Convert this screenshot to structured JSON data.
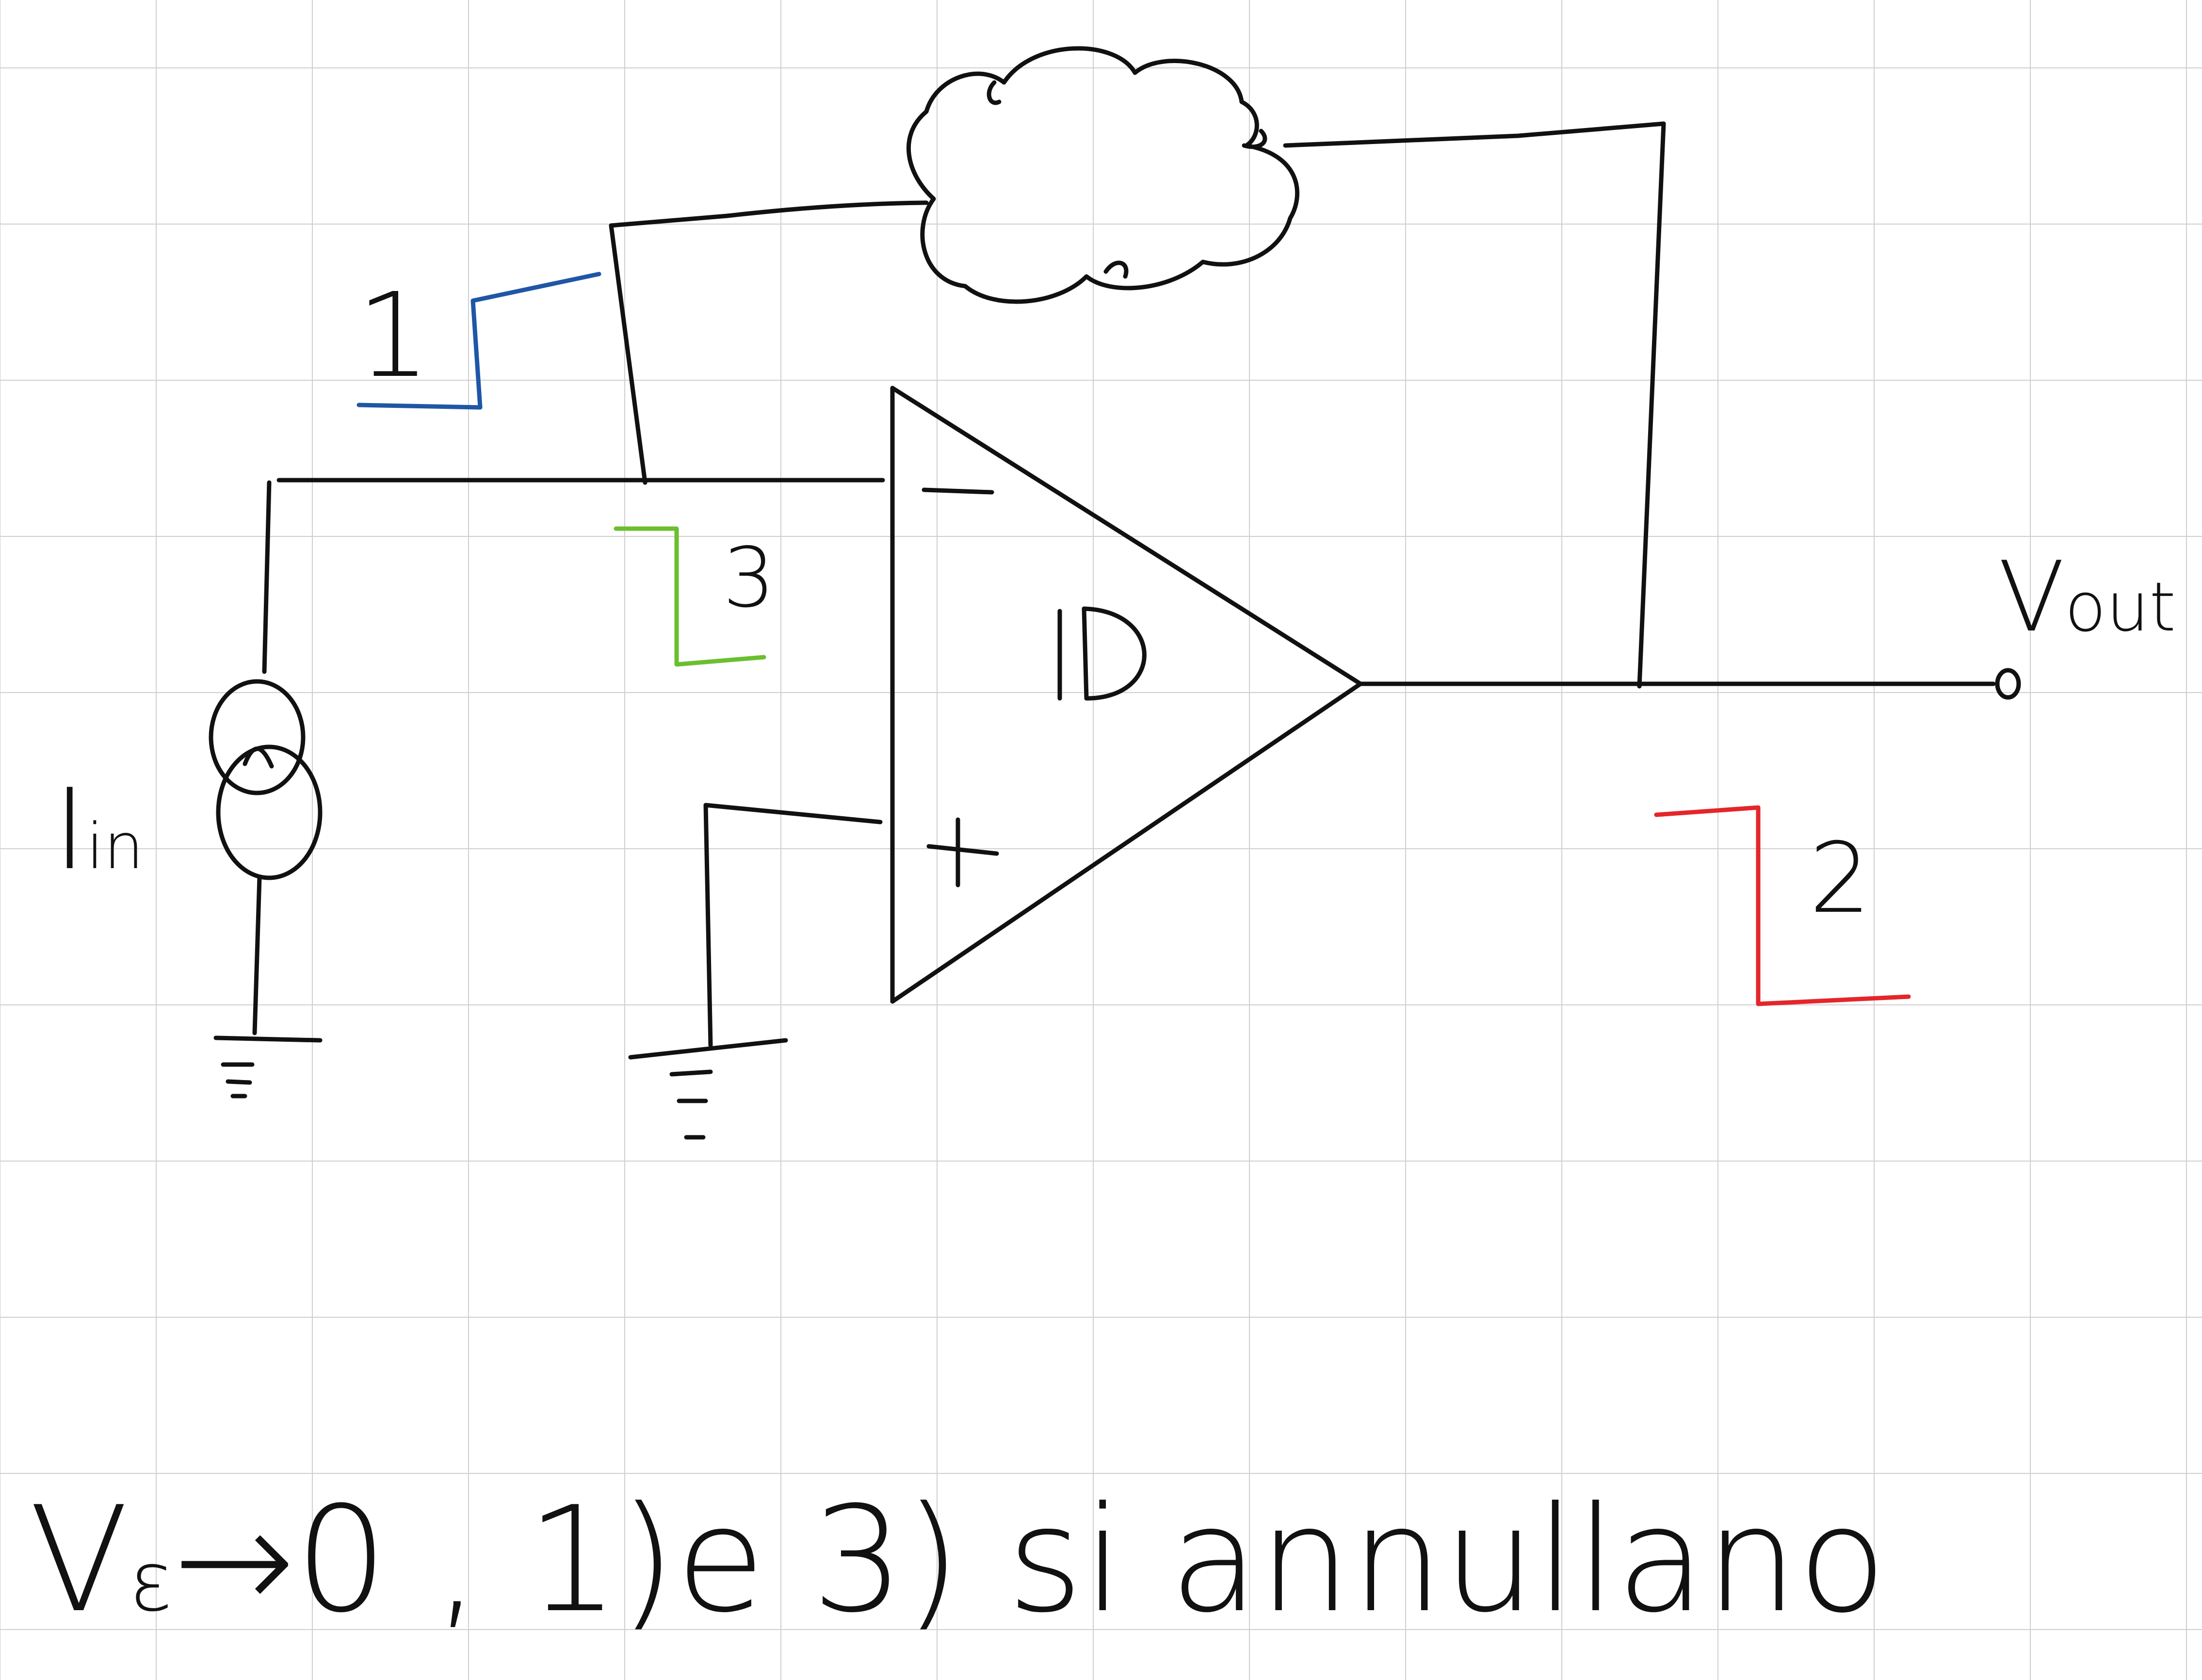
{
  "diagram": {
    "labels": {
      "current_source": "Iin",
      "current_source_main": "I",
      "current_source_sub": "in",
      "output": "Vout",
      "output_main": "V",
      "output_sub": "out",
      "opamp": "ID",
      "opamp_minus": "−",
      "opamp_plus": "+",
      "loop1": "1",
      "loop2": "2",
      "loop3": "3"
    },
    "note": {
      "v_main": "V",
      "v_sub": "ε",
      "rest": "→0 , 1)e 3) si annullano"
    },
    "colors": {
      "ink": "#111111",
      "loop1": "#1f56a6",
      "loop2": "#e4262a",
      "loop3": "#6bbf2f",
      "grid": "#cfcfcf"
    }
  }
}
